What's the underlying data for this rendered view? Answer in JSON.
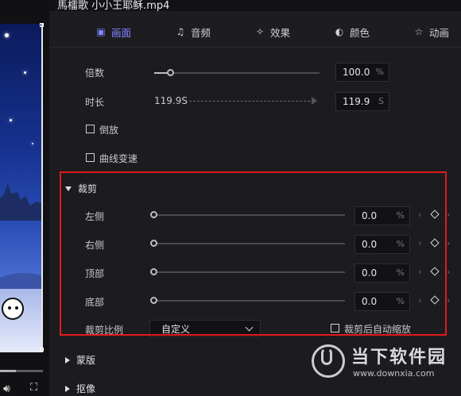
{
  "window": {
    "title": "馬檑歌 小小王耶稣.mp4"
  },
  "tabs": [
    {
      "label": "画面",
      "icon": "picture-icon",
      "active": true
    },
    {
      "label": "音频",
      "icon": "music-note-icon",
      "active": false
    },
    {
      "label": "效果",
      "icon": "magic-wand-icon",
      "active": false
    },
    {
      "label": "颜色",
      "icon": "palette-icon",
      "active": false
    },
    {
      "label": "动画",
      "icon": "animation-icon",
      "active": false
    }
  ],
  "speed": {
    "rate_label": "倍数",
    "rate_value": "100.0",
    "rate_unit": "%",
    "rate_slider_fraction": 0.15,
    "duration_label": "时长",
    "duration_original": "119.9S",
    "duration_value": "119.9",
    "duration_unit": "S",
    "reverse_label": "倒放",
    "curve_label": "曲线变速"
  },
  "crop": {
    "section_label": "裁剪",
    "rows": [
      {
        "label": "左侧",
        "value": "0.0",
        "unit": "%",
        "slider_fraction": 0
      },
      {
        "label": "右侧",
        "value": "0.0",
        "unit": "%",
        "slider_fraction": 0
      },
      {
        "label": "顶部",
        "value": "0.0",
        "unit": "%",
        "slider_fraction": 0
      },
      {
        "label": "底部",
        "value": "0.0",
        "unit": "%",
        "slider_fraction": 0
      }
    ],
    "ratio_label": "裁剪比例",
    "ratio_value": "自定义",
    "auto_zoom_label": "裁剪后自动缩放"
  },
  "sections": {
    "mask_label": "蒙版",
    "matting_label": "抠像"
  },
  "watermark": {
    "name": "当下软件园",
    "url": "www.downxia.com"
  },
  "colors": {
    "accent": "#7f86ff",
    "highlight_border": "#e01b1b",
    "background": "#1c1c1f"
  }
}
